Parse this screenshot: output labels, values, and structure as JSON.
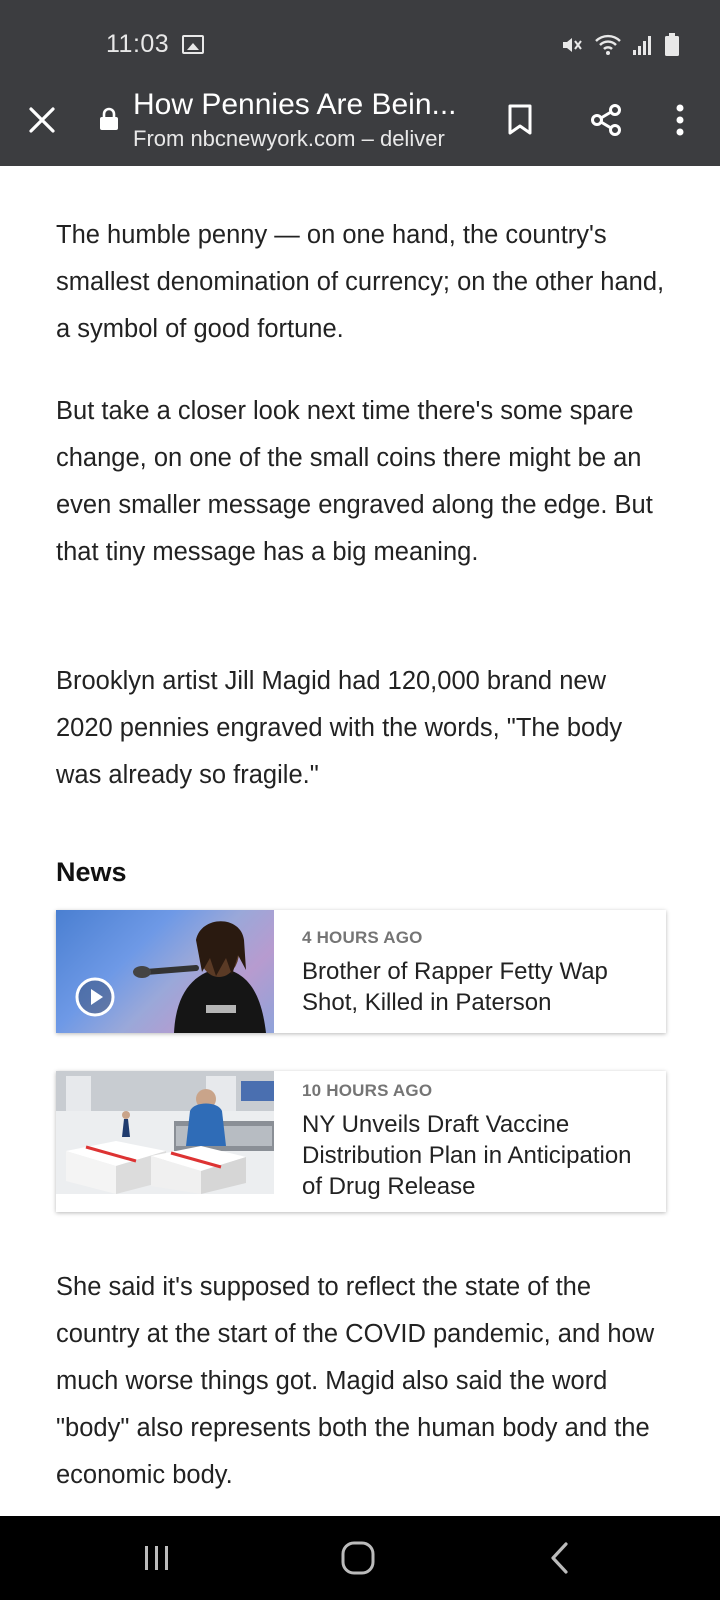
{
  "status": {
    "time": "11:03"
  },
  "toolbar": {
    "title": "How Pennies Are Bein...",
    "subtitle": "From nbcnewyork.com – deliver"
  },
  "article": {
    "paragraphs": [
      "The humble penny — on one hand, the country's smallest denomination of currency; on the other hand, a symbol of good fortune.",
      "But take a closer look next time there's some spare change, on one of the small coins there might be an even smaller message engraved along the edge. But that tiny message has a big meaning.",
      "Brooklyn artist Jill Magid had 120,000 brand new 2020 pennies engraved with the words, \"The body was already so fragile.\"",
      "She said it's supposed to reflect the state of the country at the start of the COVID pandemic, and how much worse things got. Magid also said the word \"body\" also represents both the human body and the economic body."
    ]
  },
  "news": {
    "heading": "News",
    "items": [
      {
        "time": "4 HOURS AGO",
        "title": "Brother of Rapper Fetty Wap Shot, Killed in Paterson",
        "has_video": true
      },
      {
        "time": "10 HOURS AGO",
        "title": "NY Unveils Draft Vaccine Distribution Plan in Anticipation of Drug Release",
        "has_video": false
      }
    ]
  },
  "icons": {
    "status": [
      "image-icon",
      "mute-icon",
      "wifi-icon",
      "signal-icon",
      "battery-icon"
    ],
    "toolbar": [
      "close-icon",
      "lock-icon",
      "bookmark-icon",
      "share-icon",
      "more-vert-icon"
    ],
    "nav": [
      "recent-apps-icon",
      "home-icon",
      "back-icon"
    ]
  },
  "colors": {
    "toolbar_bg": "#3c3d40",
    "text": "#222222",
    "meta": "#757575",
    "nav_bg": "#000000"
  }
}
